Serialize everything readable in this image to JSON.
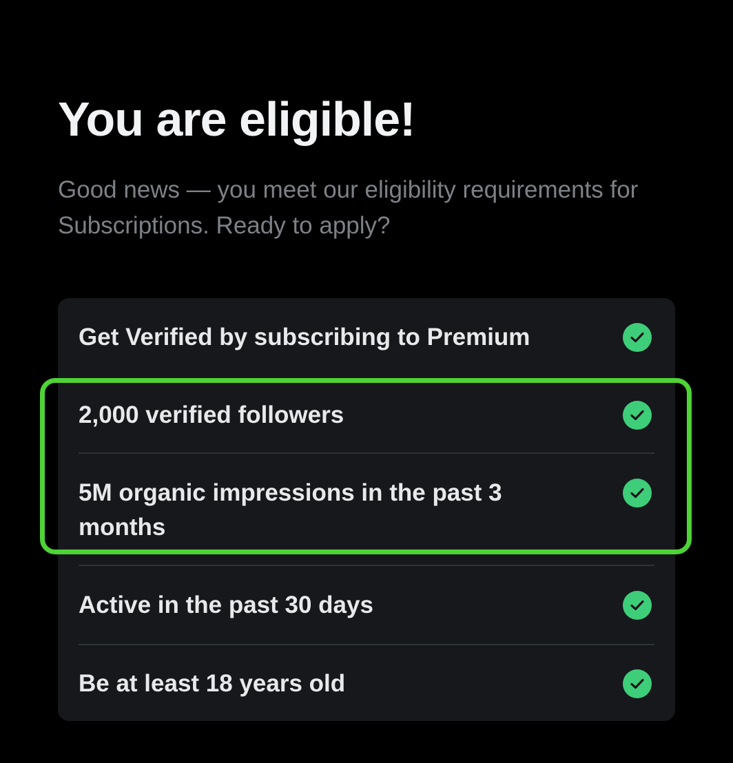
{
  "header": {
    "title": "You are eligible!",
    "subtitle": "Good news — you meet our eligibility requirements for Subscriptions. Ready to apply?"
  },
  "requirements": [
    {
      "label": "Get Verified by subscribing to Premium",
      "icon": "check-circle-icon",
      "met": true
    },
    {
      "label": "2,000 verified followers",
      "icon": "check-circle-icon",
      "met": true
    },
    {
      "label": "5M organic impressions in the past 3 months",
      "icon": "check-circle-icon",
      "met": true
    },
    {
      "label": "Active in the past 30 days",
      "icon": "check-circle-icon",
      "met": true
    },
    {
      "label": "Be at least 18 years old",
      "icon": "check-circle-icon",
      "met": true
    }
  ],
  "colors": {
    "background": "#000000",
    "card": "#16181c",
    "check": "#3ece79",
    "highlight": "#4ed336",
    "subtitle": "#7d8186"
  }
}
